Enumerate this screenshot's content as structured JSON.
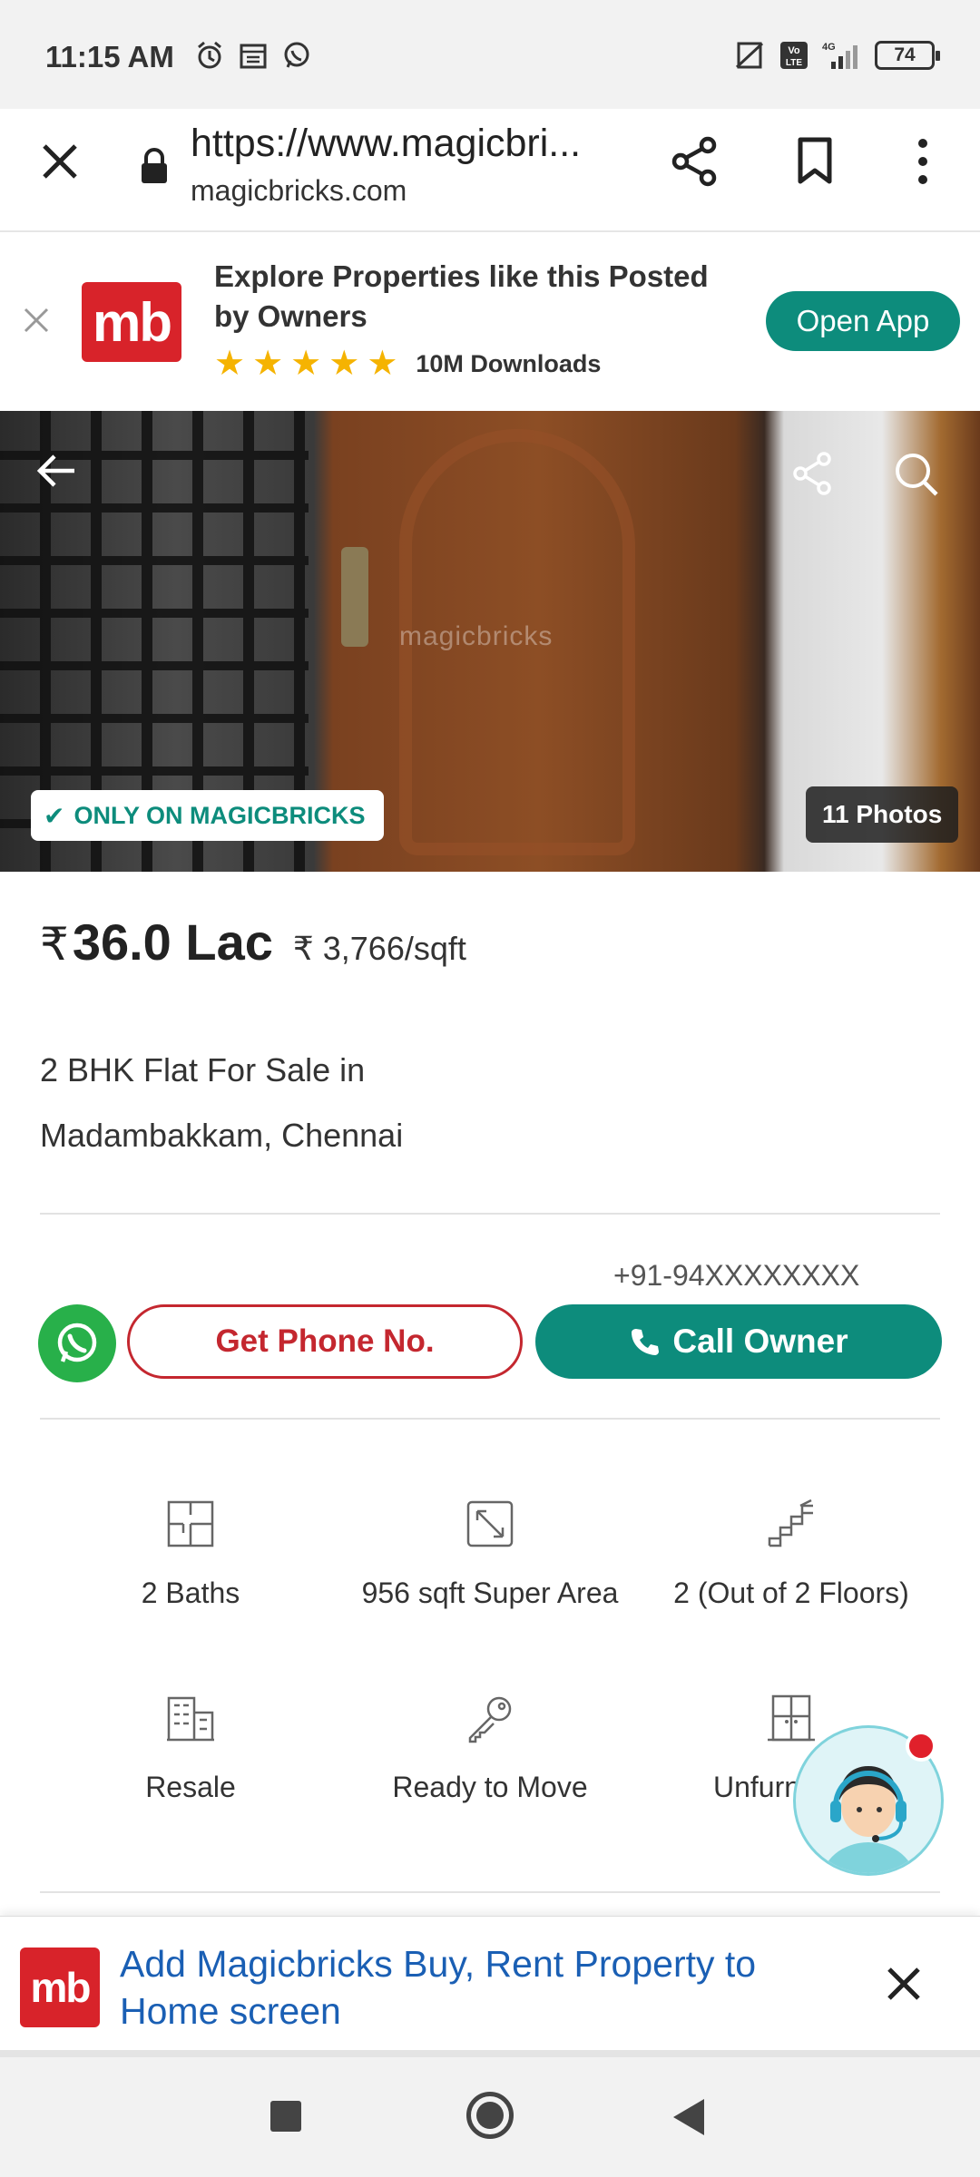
{
  "status_bar": {
    "time": "11:15 AM",
    "battery": "74",
    "network": "4G",
    "icons_left": [
      "alarm-icon",
      "calendar-icon",
      "whatsapp-icon"
    ],
    "icons_right": [
      "no-sim-icon",
      "volte-icon",
      "signal-icon",
      "battery-icon"
    ]
  },
  "browser": {
    "url": "https://www.magicbricks.com",
    "url_display": "https://www.magicbri...",
    "domain": "magicbricks.com"
  },
  "promo": {
    "logo_text": "mb",
    "title": "Explore Properties like this Posted by Owners",
    "rating_stars": 5,
    "downloads": "10M Downloads",
    "open_app_label": "Open App"
  },
  "photo": {
    "watermark": "magicbricks",
    "badge": "ONLY ON MAGICBRICKS",
    "photos_count": "11 Photos"
  },
  "listing": {
    "currency_symbol": "₹",
    "price": "36.0 Lac",
    "price_per_sqft": "₹ 3,766/sqft",
    "title_line1": "2 BHK Flat For Sale in",
    "title_line2": "Madambakkam, Chennai"
  },
  "contact": {
    "masked_phone": "+91-94XXXXXXXX",
    "get_phone_label": "Get Phone No.",
    "call_owner_label": "Call Owner"
  },
  "features": [
    {
      "icon": "floorplan-icon",
      "label": "2 Baths"
    },
    {
      "icon": "area-icon",
      "label": "956 sqft Super Area"
    },
    {
      "icon": "stairs-icon",
      "label": "2 (Out of 2 Floors)"
    },
    {
      "icon": "building-icon",
      "label": "Resale"
    },
    {
      "icon": "key-icon",
      "label": "Ready to Move"
    },
    {
      "icon": "door-icon",
      "label": "Unfurn"
    }
  ],
  "add_to_home": {
    "logo_text": "mb",
    "text": "Add Magicbricks Buy, Rent Property to Home screen"
  },
  "colors": {
    "brand_red": "#d8232a",
    "brand_teal": "#0d8c7c",
    "link_blue": "#1a5fb4",
    "star": "#f5b301"
  }
}
